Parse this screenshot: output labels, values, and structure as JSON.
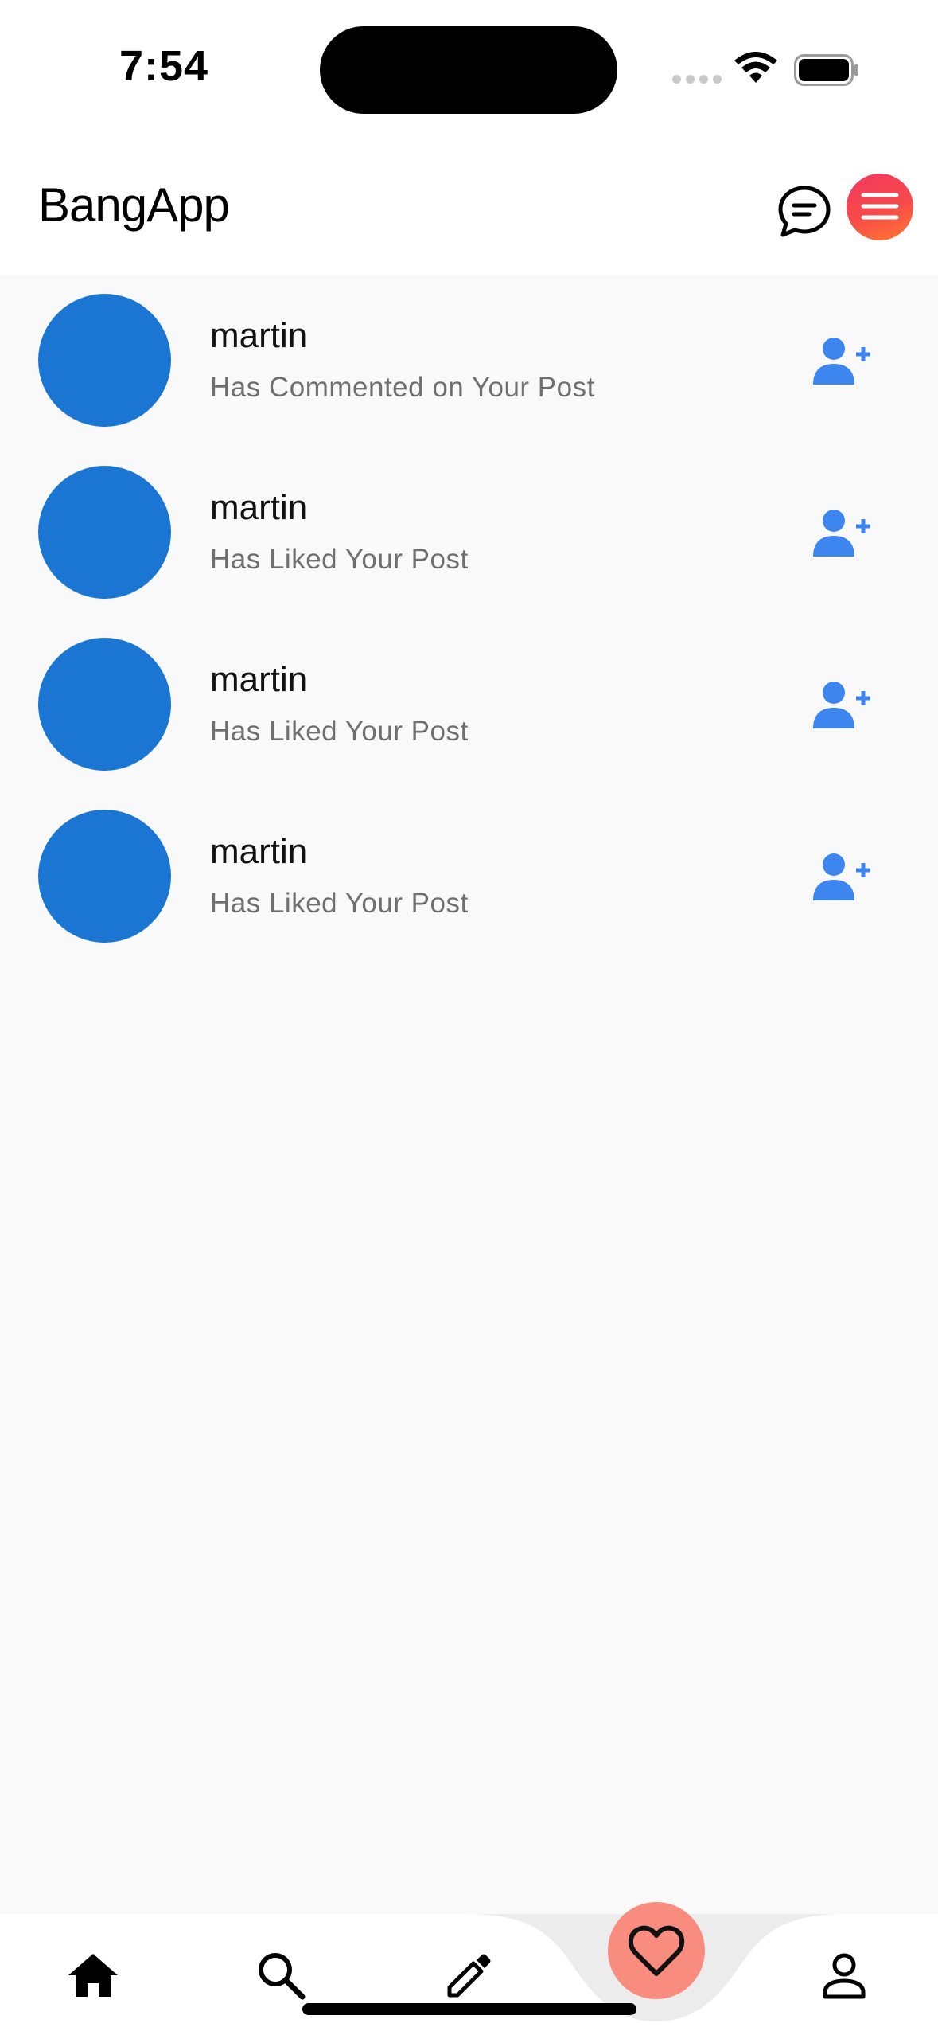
{
  "status_bar": {
    "time": "7:54"
  },
  "header": {
    "app_title": "BangApp",
    "chat_icon": "chat-bubble-icon",
    "menu_icon": "menu-lines-icon",
    "menu_gradient": [
      "#f3385f",
      "#ff7a2f"
    ]
  },
  "notifications": [
    {
      "name": "martin",
      "message": "Has Commented on Your Post",
      "action_icon": "add-user-icon"
    },
    {
      "name": "martin",
      "message": "Has Liked Your Post",
      "action_icon": "add-user-icon"
    },
    {
      "name": "martin",
      "message": "Has Liked Your Post",
      "action_icon": "add-user-icon"
    },
    {
      "name": "martin",
      "message": "Has Liked Your Post",
      "action_icon": "add-user-icon"
    }
  ],
  "bottom_nav": {
    "items": [
      "home-icon",
      "search-icon",
      "edit-icon",
      "heart-icon",
      "profile-icon"
    ],
    "active": "heart-icon"
  },
  "colors": {
    "avatar": "#1b76d3",
    "add_user_icon": "#3d86f0",
    "active_nav": "#f78c7f",
    "background": "#f9f9f9"
  }
}
